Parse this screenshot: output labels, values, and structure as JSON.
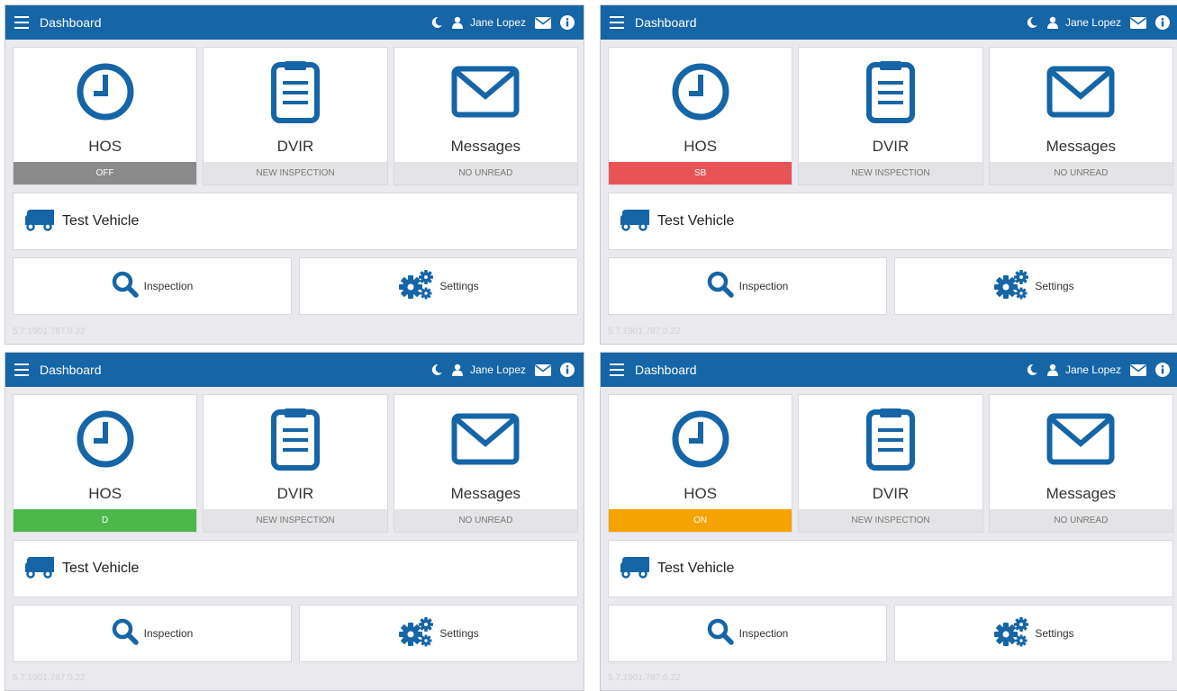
{
  "colors": {
    "header": "#1565a7",
    "icon_blue": "#1565a7",
    "status_off": "#8a8a8a",
    "status_sb": "#e85455",
    "status_d": "#4cb84a",
    "status_on": "#f5a300",
    "status_neutral": "#e4e4e6"
  },
  "panels": [
    {
      "header": {
        "title": "Dashboard",
        "user_name": "Jane Lopez"
      },
      "hos": {
        "label": "HOS",
        "status": "OFF",
        "status_color": "#8a8a8a"
      },
      "dvir": {
        "label": "DVIR",
        "status": "NEW INSPECTION"
      },
      "messages": {
        "label": "Messages",
        "status": "NO UNREAD"
      },
      "vehicle": {
        "name": "Test Vehicle"
      },
      "actions": {
        "inspection": "Inspection",
        "settings": "Settings"
      },
      "version": "5.7.1901.787.0.22"
    },
    {
      "header": {
        "title": "Dashboard",
        "user_name": "Jane Lopez"
      },
      "hos": {
        "label": "HOS",
        "status": "SB",
        "status_color": "#e85455"
      },
      "dvir": {
        "label": "DVIR",
        "status": "NEW INSPECTION"
      },
      "messages": {
        "label": "Messages",
        "status": "NO UNREAD"
      },
      "vehicle": {
        "name": "Test Vehicle"
      },
      "actions": {
        "inspection": "Inspection",
        "settings": "Settings"
      },
      "version": "5.7.1901.787.0.22"
    },
    {
      "header": {
        "title": "Dashboard",
        "user_name": "Jane Lopez"
      },
      "hos": {
        "label": "HOS",
        "status": "D",
        "status_color": "#4cb84a"
      },
      "dvir": {
        "label": "DVIR",
        "status": "NEW INSPECTION"
      },
      "messages": {
        "label": "Messages",
        "status": "NO UNREAD"
      },
      "vehicle": {
        "name": "Test Vehicle"
      },
      "actions": {
        "inspection": "Inspection",
        "settings": "Settings"
      },
      "version": "5.7.1901.787.0.22"
    },
    {
      "header": {
        "title": "Dashboard",
        "user_name": "Jane Lopez"
      },
      "hos": {
        "label": "HOS",
        "status": "ON",
        "status_color": "#f5a300"
      },
      "dvir": {
        "label": "DVIR",
        "status": "NEW INSPECTION"
      },
      "messages": {
        "label": "Messages",
        "status": "NO UNREAD"
      },
      "vehicle": {
        "name": "Test Vehicle"
      },
      "actions": {
        "inspection": "Inspection",
        "settings": "Settings"
      },
      "version": "5.7.1901.787.0.22"
    }
  ]
}
